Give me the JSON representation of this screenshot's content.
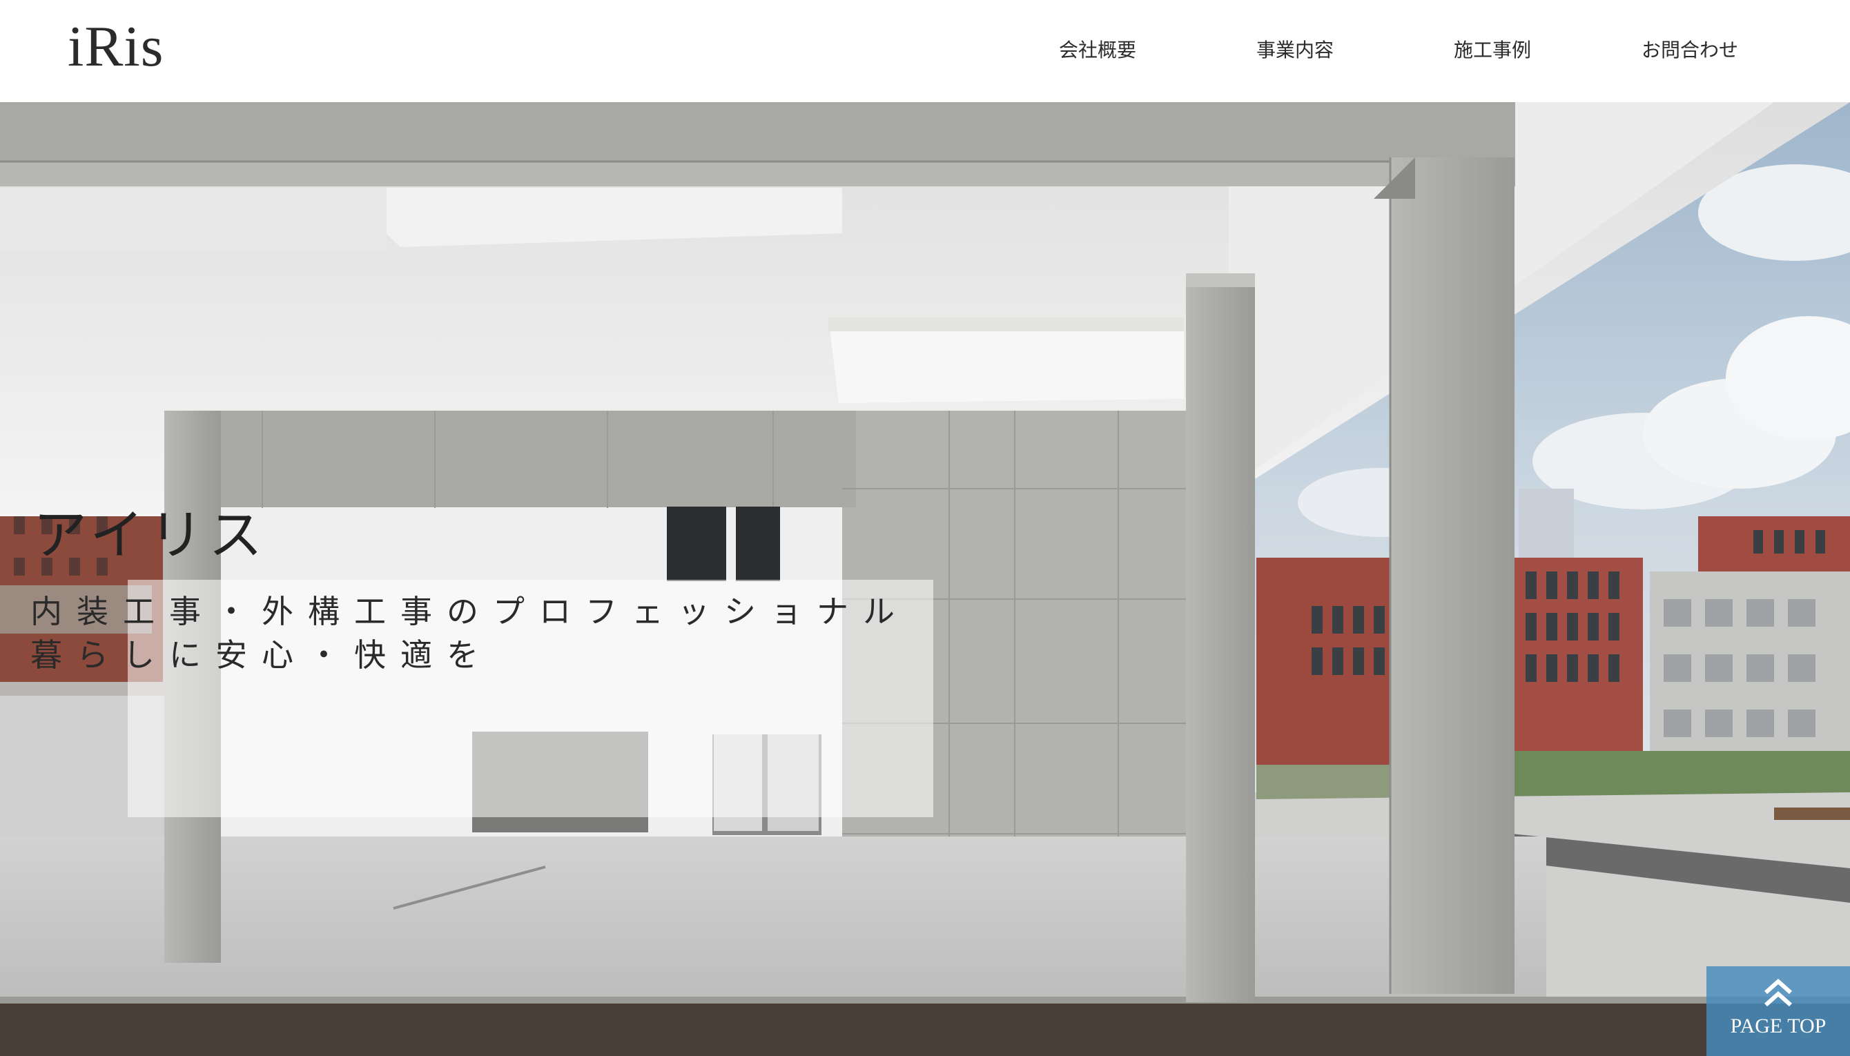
{
  "header": {
    "logo": "iRis",
    "nav": [
      {
        "label": "会社概要"
      },
      {
        "label": "事業内容"
      },
      {
        "label": "施工事例"
      },
      {
        "label": "お問合わせ"
      }
    ]
  },
  "hero": {
    "title": "アイリス",
    "line1": "内装工事・外構工事のプロフェッショナル",
    "line2": "暮らしに安心・快適を"
  },
  "page_top": {
    "label": "PAGE TOP",
    "icon": "double-chevron-up-icon"
  },
  "colors": {
    "text": "#2b2b2b",
    "page_top_bg": "#468cbe"
  }
}
